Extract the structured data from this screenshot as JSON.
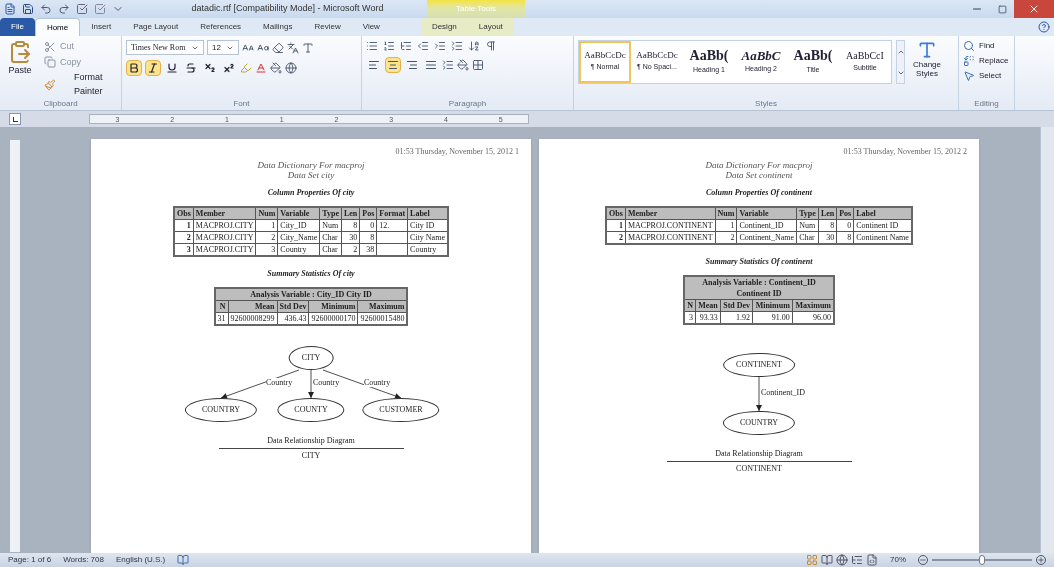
{
  "window": {
    "title": "datadic.rtf [Compatibility Mode] - Microsoft Word",
    "context_title": "Table Tools"
  },
  "tabs": [
    {
      "label": "File",
      "kind": "file",
      "selected": false
    },
    {
      "label": "Home",
      "kind": "main",
      "selected": true
    },
    {
      "label": "Insert",
      "kind": "main",
      "selected": false
    },
    {
      "label": "Page Layout",
      "kind": "main",
      "selected": false
    },
    {
      "label": "References",
      "kind": "main",
      "selected": false
    },
    {
      "label": "Mailings",
      "kind": "main",
      "selected": false
    },
    {
      "label": "Review",
      "kind": "main",
      "selected": false
    },
    {
      "label": "View",
      "kind": "main",
      "selected": false
    },
    {
      "label": "Design",
      "kind": "context",
      "selected": false
    },
    {
      "label": "Layout",
      "kind": "context",
      "selected": false
    }
  ],
  "clipboard": {
    "paste": "Paste",
    "cut": "Cut",
    "copy": "Copy",
    "format_painter": "Format Painter",
    "group": "Clipboard"
  },
  "font": {
    "name": "Times New Rom",
    "size": "12",
    "group": "Font",
    "format_buttons": [
      {
        "kind": "bold",
        "selected": true
      },
      {
        "kind": "italic",
        "selected": true
      },
      {
        "kind": "underline",
        "selected": false
      },
      {
        "kind": "strike",
        "selected": false
      },
      {
        "kind": "subscript",
        "selected": false
      },
      {
        "kind": "superscript",
        "selected": false
      }
    ]
  },
  "paragraph": {
    "group": "Paragraph",
    "align_buttons": [
      {
        "kind": "left",
        "selected": false
      },
      {
        "kind": "center",
        "selected": true
      },
      {
        "kind": "right",
        "selected": false
      },
      {
        "kind": "justify",
        "selected": false
      }
    ]
  },
  "styles": {
    "group": "Styles",
    "change": "Change Styles",
    "items": [
      {
        "preview": "AaBbCcDc",
        "name": "¶ Normal",
        "kind": "normal",
        "selected": true
      },
      {
        "preview": "AaBbCcDc",
        "name": "¶ No Spaci...",
        "kind": "normal",
        "selected": false
      },
      {
        "preview": "AaBb(",
        "name": "Heading 1",
        "kind": "heading1",
        "selected": false
      },
      {
        "preview": "AaBbC",
        "name": "Heading 2",
        "kind": "heading2",
        "selected": false
      },
      {
        "preview": "AaBb(",
        "name": "Title",
        "kind": "title",
        "selected": false
      },
      {
        "preview": "AaBbCcI",
        "name": "Subtitle",
        "kind": "subtitle",
        "selected": false
      }
    ]
  },
  "editing": {
    "group": "Editing",
    "find": "Find",
    "replace": "Replace",
    "select": "Select"
  },
  "ruler": [
    "3",
    "2",
    "1",
    "1",
    "2",
    "3",
    "4",
    "5"
  ],
  "pages": [
    {
      "header": "01:53 Thursday, November 15, 2012 1",
      "title": "Data Dictionary For macproj",
      "subtitle": "Data Set city",
      "columns_title": "Column Properties Of city",
      "columns": [
        "Obs",
        "Member",
        "Num",
        "Variable",
        "Type",
        "Len",
        "Pos",
        "Format",
        "Label"
      ],
      "rows": [
        [
          "1",
          "MACPROJ.CITY",
          "1",
          "City_ID",
          "Num",
          "8",
          "0",
          "12.",
          "City ID"
        ],
        [
          "2",
          "MACPROJ.CITY",
          "2",
          "City_Name",
          "Char",
          "30",
          "8",
          null,
          "City Name"
        ],
        [
          "3",
          "MACPROJ.CITY",
          "3",
          "Country",
          "Char",
          "2",
          "38",
          null,
          "Country"
        ]
      ],
      "summary_title": "Summary Statistics Of city",
      "summary_heading": "Analysis Variable : City_ID City ID",
      "summary_columns": [
        "N",
        "Mean",
        "Std Dev",
        "Minimum",
        "Maximum"
      ],
      "summary_row": [
        "31",
        "92600008299",
        "436.43",
        "92600000170",
        "92600015480"
      ],
      "diagram": {
        "root": "CITY",
        "children": [
          {
            "name": "COUNTRY",
            "edge_label": "Country"
          },
          {
            "name": "COUNTY",
            "edge_label": "Country"
          },
          {
            "name": "CUSTOMER",
            "edge_label": "Country"
          }
        ],
        "caption": "Data Relationship Diagram",
        "footer": "CITY"
      }
    },
    {
      "header": "01:53 Thursday, November 15, 2012 2",
      "title": "Data Dictionary For macproj",
      "subtitle": "Data Set continent",
      "columns_title": "Column Properties Of continent",
      "columns": [
        "Obs",
        "Member",
        "Num",
        "Variable",
        "Type",
        "Len",
        "Pos",
        "Label"
      ],
      "rows": [
        [
          "1",
          "MACPROJ.CONTINENT",
          "1",
          "Continent_ID",
          "Num",
          "8",
          "0",
          "Continent ID"
        ],
        [
          "2",
          "MACPROJ.CONTINENT",
          "2",
          "Continent_Name",
          "Char",
          "30",
          "8",
          "Continent Name"
        ]
      ],
      "summary_title": "Summary Statistics Of continent",
      "summary_heading": "Analysis Variable : Continent_ID Continent ID",
      "summary_columns": [
        "N",
        "Mean",
        "Std Dev",
        "Minimum",
        "Maximum"
      ],
      "summary_row": [
        "3",
        "93.33",
        "1.92",
        "91.00",
        "96.00"
      ],
      "diagram": {
        "root": "CONTINENT",
        "children": [
          {
            "name": "COUNTRY",
            "edge_label": "Continent_ID"
          }
        ],
        "caption": "Data Relationship Diagram",
        "footer": "CONTINENT"
      }
    }
  ],
  "status": {
    "page": "Page: 1 of 6",
    "words": "Words: 708",
    "language": "English (U.S.)",
    "zoom": "70%",
    "level": 0.5
  }
}
